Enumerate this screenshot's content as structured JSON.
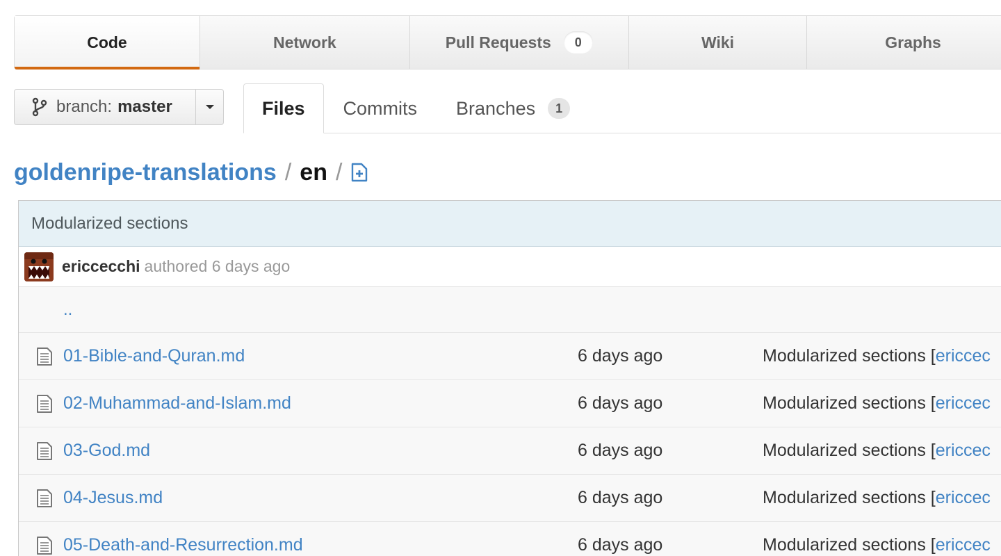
{
  "repo_nav": {
    "tabs": [
      {
        "label": "Code"
      },
      {
        "label": "Network"
      },
      {
        "label": "Pull Requests",
        "count": "0"
      },
      {
        "label": "Wiki"
      },
      {
        "label": "Graphs"
      }
    ]
  },
  "branch": {
    "prefix": "branch:",
    "name": "master"
  },
  "subnav": {
    "tabs": [
      {
        "label": "Files"
      },
      {
        "label": "Commits"
      },
      {
        "label": "Branches",
        "count": "1"
      }
    ]
  },
  "breadcrumb": {
    "repo": "goldenripe-translations",
    "sep": "/",
    "current": "en"
  },
  "commit": {
    "title": "Modularized sections",
    "author": "ericcecchi",
    "meta": "authored 6 days ago"
  },
  "files": {
    "up_label": "..",
    "rows": [
      {
        "name": "01-Bible-and-Quran.md",
        "age": "6 days ago",
        "message": "Modularized sections [",
        "author": "ericcec"
      },
      {
        "name": "02-Muhammad-and-Islam.md",
        "age": "6 days ago",
        "message": "Modularized sections [",
        "author": "ericcec"
      },
      {
        "name": "03-God.md",
        "age": "6 days ago",
        "message": "Modularized sections [",
        "author": "ericcec"
      },
      {
        "name": "04-Jesus.md",
        "age": "6 days ago",
        "message": "Modularized sections [",
        "author": "ericcec"
      },
      {
        "name": "05-Death-and-Resurrection.md",
        "age": "6 days ago",
        "message": "Modularized sections [",
        "author": "ericcec"
      }
    ]
  },
  "colors": {
    "accent": "#d26911",
    "link": "#4183c4"
  }
}
